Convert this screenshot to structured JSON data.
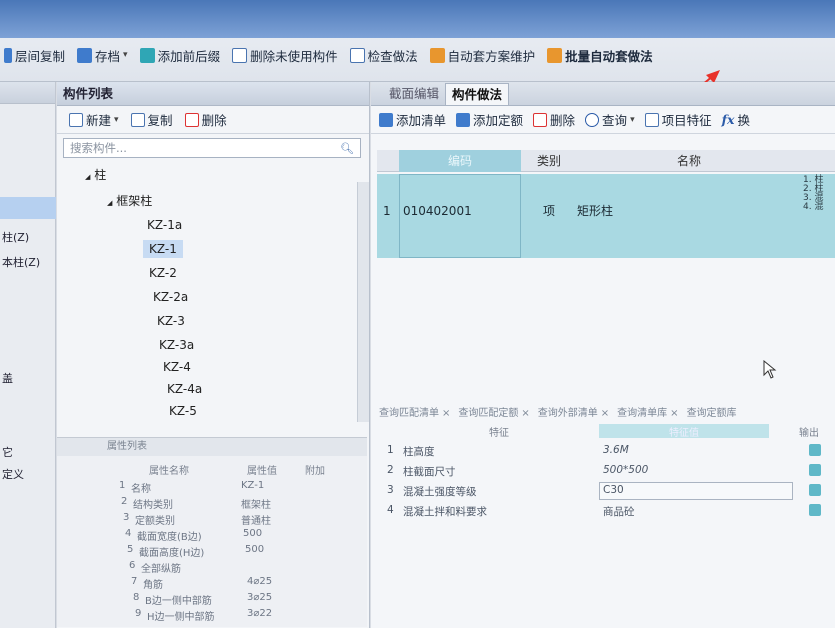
{
  "toolbar": {
    "items": [
      {
        "label": "层间复制",
        "icon": "copy-floor-icon"
      },
      {
        "label": "存档",
        "icon": "save-icon",
        "dropdown": "▾"
      },
      {
        "label": "添加前后缀",
        "icon": "prefix-icon"
      },
      {
        "label": "删除未使用构件",
        "icon": "delete-unused-icon"
      },
      {
        "label": "检查做法",
        "icon": "check-icon"
      },
      {
        "label": "自动套方案维护",
        "icon": "scheme-icon"
      },
      {
        "label": "批量自动套做法",
        "icon": "batch-icon"
      }
    ]
  },
  "left_strip": {
    "items": [
      "柱(Z)",
      "本柱(Z)",
      "盖",
      "它",
      "定义"
    ]
  },
  "component_list": {
    "title": "构件列表",
    "actions": {
      "new": "新建",
      "new_dropdown": "▾",
      "copy": "复制",
      "delete": "删除"
    },
    "search_placeholder": "搜索构件...",
    "search_icon": "search-icon",
    "tree": {
      "root": "柱",
      "root_toggle": "◢",
      "group": "框架柱",
      "group_toggle": "◢",
      "items": [
        "KZ-1a",
        "KZ-1",
        "KZ-2",
        "KZ-2a",
        "KZ-3",
        "KZ-3a",
        "KZ-4",
        "KZ-4a",
        "KZ-5"
      ],
      "selected": "KZ-1"
    }
  },
  "properties": {
    "title": "属性列表",
    "headers": {
      "name": "属性名称",
      "value": "属性值",
      "extra": "附加"
    },
    "rows": [
      {
        "no": "1",
        "name": "名称",
        "value": "KZ-1"
      },
      {
        "no": "2",
        "name": "结构类别",
        "value": "框架柱"
      },
      {
        "no": "3",
        "name": "定额类别",
        "value": "普通柱"
      },
      {
        "no": "4",
        "name": "截面宽度(B边)",
        "value": "500"
      },
      {
        "no": "5",
        "name": "截面高度(H边)",
        "value": "500"
      },
      {
        "no": "6",
        "name": "全部纵筋",
        "value": ""
      },
      {
        "no": "7",
        "name": "角筋",
        "value": "4⌀25"
      },
      {
        "no": "8",
        "name": "B边一侧中部筋",
        "value": "3⌀25"
      },
      {
        "no": "9",
        "name": "H边一侧中部筋",
        "value": "3⌀22"
      }
    ]
  },
  "right_panel": {
    "tabs": [
      "截面编辑",
      "构件做法"
    ],
    "active_tab": "构件做法",
    "actions": {
      "add_list": "添加清单",
      "add_quota": "添加定额",
      "delete": "删除",
      "query": "查询",
      "query_dropdown": "▾",
      "project_feature": "项目特征",
      "fx": "fx",
      "replace": "换"
    },
    "grid": {
      "headers": {
        "code": "编码",
        "category": "类别",
        "name": "名称"
      },
      "rows": [
        {
          "no": "1",
          "code": "010402001",
          "category": "项",
          "name": "矩形柱",
          "desc": [
            "1. 柱",
            "2. 柱",
            "3. 混",
            "4. 混"
          ]
        }
      ]
    },
    "bottom_tabs": [
      {
        "label": "查询匹配清单",
        "close": "×"
      },
      {
        "label": "查询匹配定额",
        "close": "×"
      },
      {
        "label": "查询外部清单",
        "close": "×"
      },
      {
        "label": "查询清单库",
        "close": "×"
      },
      {
        "label": "查询定额库",
        "close": ""
      }
    ],
    "features": {
      "headers": {
        "feature": "特征",
        "value": "特征值",
        "output": "输出"
      },
      "rows": [
        {
          "no": "1",
          "name": "柱高度",
          "value": "3.6M",
          "checked": true
        },
        {
          "no": "2",
          "name": "柱截面尺寸",
          "value": "500*500",
          "checked": true
        },
        {
          "no": "3",
          "name": "混凝土强度等级",
          "value": "C30",
          "checked": true
        },
        {
          "no": "4",
          "name": "混凝土拌和料要求",
          "value": "商品砼",
          "checked": true
        }
      ]
    }
  },
  "colors": {
    "selected_row": "#a9d9e2",
    "annotation_arrow": "#e8322a",
    "toolbar_bg": "#dfe4ec"
  }
}
